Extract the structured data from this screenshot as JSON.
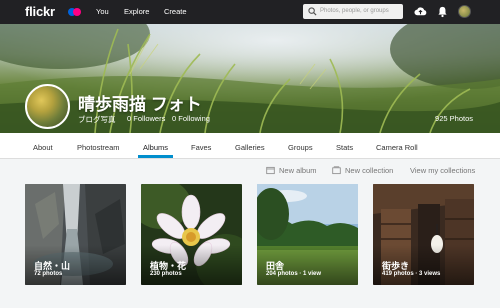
{
  "nav": {
    "logo": "flickr",
    "links": [
      "You",
      "Explore",
      "Create"
    ],
    "search_placeholder": "Photos, people, or groups"
  },
  "profile": {
    "name": "晴歩雨描 フォト",
    "subtitle": "ブログ写真",
    "followers": "0 Followers",
    "following": "0 Following",
    "photos": "925 Photos"
  },
  "tabs": [
    "About",
    "Photostream",
    "Albums",
    "Faves",
    "Galleries",
    "Groups",
    "Stats",
    "Camera Roll"
  ],
  "active_tab": "Albums",
  "actions": {
    "new_album": "New album",
    "new_collection": "New collection",
    "view_collections": "View my collections"
  },
  "albums": [
    {
      "title": "自然・山",
      "meta": "72 photos"
    },
    {
      "title": "植物・花",
      "meta": "230 photos"
    },
    {
      "title": "田舎",
      "meta": "204 photos  ·  1 view"
    },
    {
      "title": "街歩き",
      "meta": "419 photos  ·  3 views"
    }
  ],
  "colors": {
    "topnav_bg": "#212124",
    "accent": "#008ecd",
    "flickr_blue": "#0063dc",
    "flickr_pink": "#ff0084"
  }
}
